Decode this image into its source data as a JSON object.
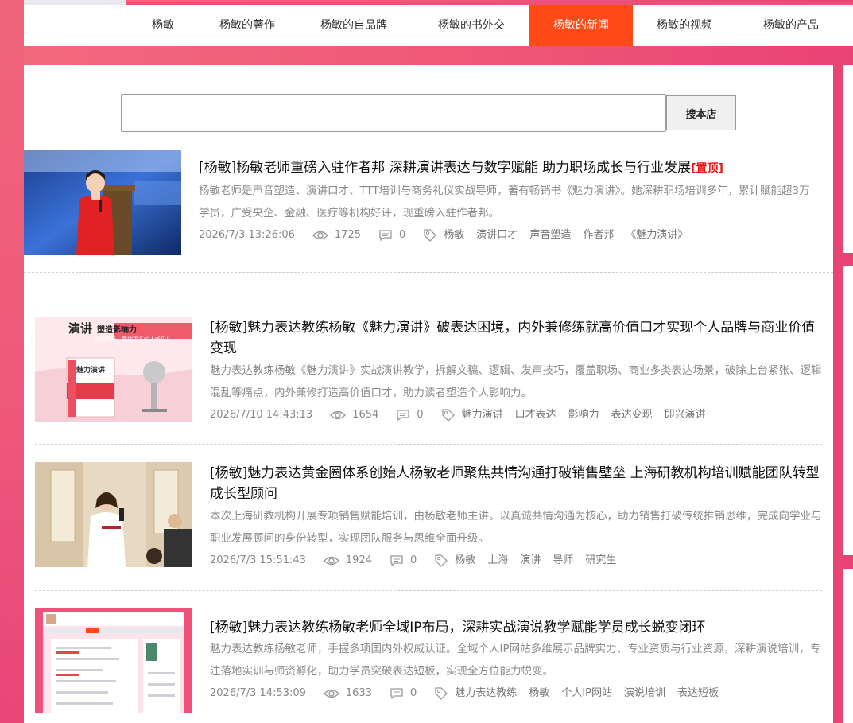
{
  "nav": {
    "items": [
      "杨敏",
      "杨敏的著作",
      "杨敏的自品牌",
      "杨敏的书外交",
      "杨敏的新闻",
      "杨敏的视频",
      "杨敏的产品"
    ],
    "active": "杨敏的新闻"
  },
  "search": {
    "placeholder": "",
    "value": "",
    "button_label": "搜本店"
  },
  "articles": [
    {
      "title": "[杨敏]杨敏老师重磅入驻作者邦 深耕演讲表达与数字赋能 助力职场成长与行业发展",
      "top_tag": "[置顶]",
      "summary": "杨敏老师是声音塑造、演讲口才、TTT培训与商务礼仪实战导师，著有畅销书《魅力演讲》。她深耕职场培训多年，累计赋能超3万学员，广受央企、金融、医疗等机构好评，现重磅入驻作者邦。",
      "date": "2026/7/3 13:26:06",
      "views": "1725",
      "comments": "0",
      "tags": [
        "杨敏",
        "演讲口才",
        "声音塑造",
        "作者邦",
        "《魅力演讲》"
      ]
    },
    {
      "title": "[杨敏]魅力表达教练杨敏《魅力演讲》破表达困境，内外兼修练就高价值口才实现个人品牌与商业价值变现",
      "summary": "魅力表达教练杨敏《魅力演讲》实战演讲教学，拆解文稿、逻辑、发声技巧，覆盖职场、商业多类表达场景，破除上台紧张、逻辑混乱等痛点，内外兼修打造高价值口才，助力读者塑造个人影响力。",
      "date": "2026/7/10 14:43:13",
      "views": "1654",
      "comments": "0",
      "tags": [
        "魅力演讲",
        "口才表达",
        "影响力",
        "表达变现",
        "即兴演讲"
      ],
      "thumb_text": {
        "heading_big": "演讲",
        "heading_small": "塑造影响力",
        "banner": "你的声音，要被更多的人听见！",
        "book": "魅力演讲"
      }
    },
    {
      "title": "[杨敏]魅力表达黄金圈体系创始人杨敏老师聚焦共情沟通打破销售壁垒 上海研教机构培训赋能团队转型成长型顾问",
      "summary": "本次上海研教机构开展专项销售赋能培训，由杨敏老师主讲。以真诚共情沟通为核心，助力销售打破传统推销思维，完成向学业与职业发展顾问的身份转型，实现团队服务与思维全面升级。",
      "date": "2026/7/3 15:51:43",
      "views": "1924",
      "comments": "0",
      "tags": [
        "杨敏",
        "上海",
        "演讲",
        "导师",
        "研究生"
      ]
    },
    {
      "title": "[杨敏]魅力表达教练杨敏老师全域IP布局，深耕实战演说教学赋能学员成长蜕变闭环",
      "summary": "魅力表达教练杨敏老师，手握多项国内外权威认证。全域个人IP网站多维展示品牌实力、专业资质与行业资源，深耕演说培训，专注落地实训与师资孵化，助力学员突破表达短板，实现全方位能力蜕变。",
      "date": "2026/7/3 14:53:09",
      "views": "1633",
      "comments": "0",
      "tags": [
        "魅力表达教练",
        "杨敏",
        "个人IP网站",
        "演说培训",
        "表达短板"
      ]
    }
  ],
  "colors": {
    "accent": "#ff4a17",
    "pink_bg": "#f05a78",
    "top_tag": "#ee1111"
  }
}
